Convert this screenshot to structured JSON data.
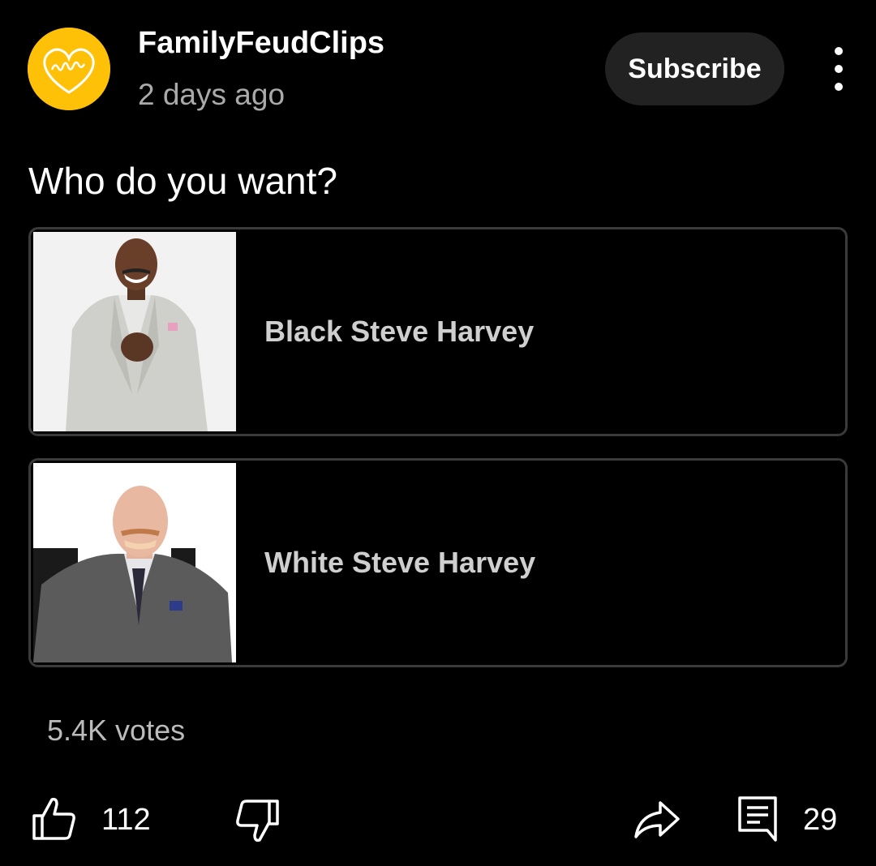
{
  "post": {
    "channel_name": "FamilyFeudClips",
    "avatar_text": "family",
    "age": "2 days ago",
    "subscribe_label": "Subscribe",
    "more_icon": "more-vert-icon"
  },
  "poll": {
    "question": "Who do you want?",
    "options": [
      {
        "label": "Black Steve Harvey"
      },
      {
        "label": "White Steve Harvey"
      }
    ],
    "votes": "5.4K votes"
  },
  "actions": {
    "like_icon": "thumb-up-icon",
    "like_count": "112",
    "dislike_icon": "thumb-down-icon",
    "share_icon": "share-icon",
    "comment_icon": "comment-icon",
    "comment_count": "29"
  },
  "colors": {
    "background": "#000000",
    "avatar": "#ffc107",
    "subscribe_bg": "#222222",
    "option_border": "#3a3a3a",
    "secondary_text": "#aaaaaa"
  }
}
